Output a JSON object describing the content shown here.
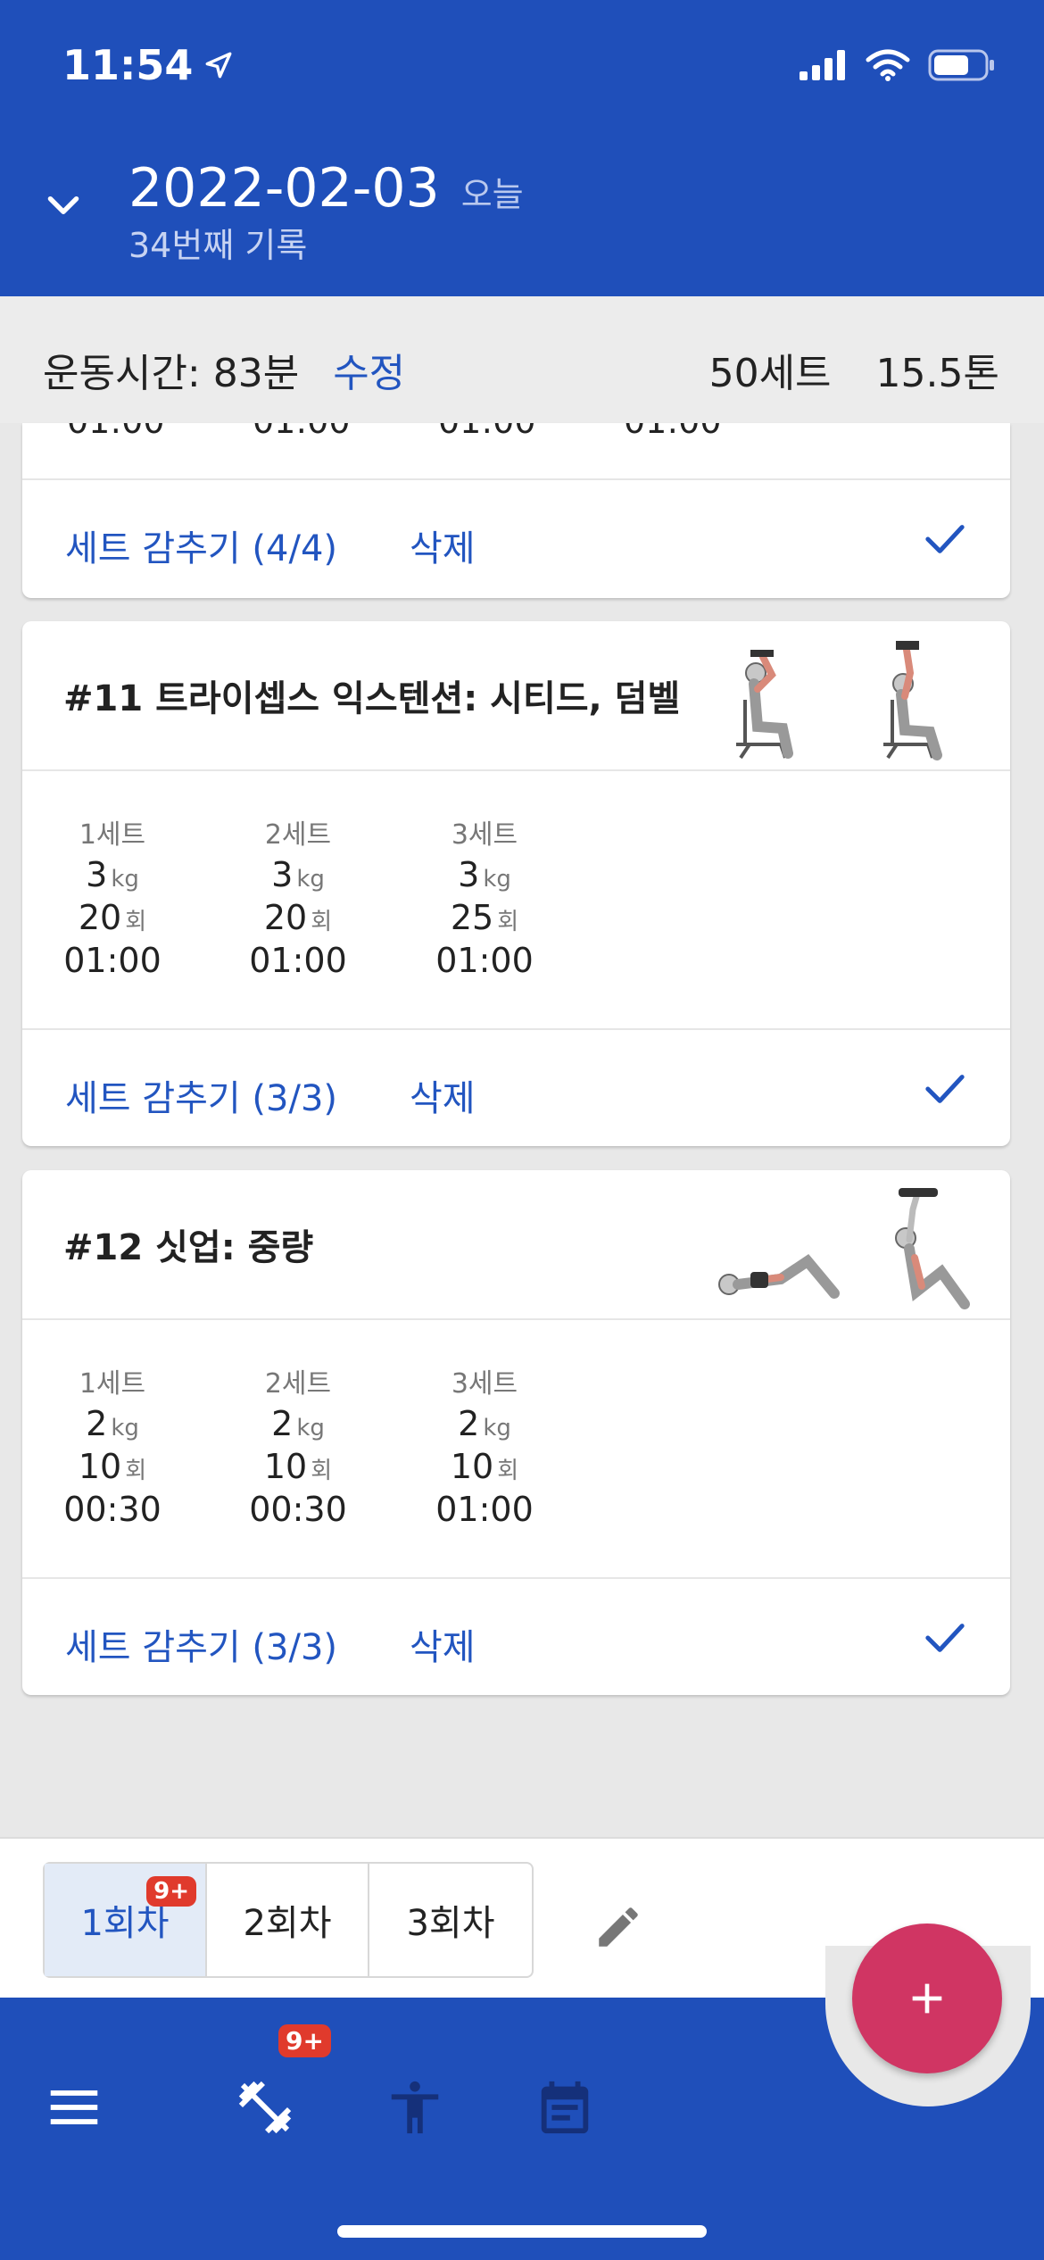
{
  "status_bar": {
    "time": "11:54"
  },
  "header": {
    "date": "2022-02-03",
    "today_label": "오늘",
    "record_count": "34번째 기록"
  },
  "summary": {
    "duration": "운동시간: 83분",
    "edit_label": "수정",
    "total_sets": "50세트",
    "total_weight": "15.5톤"
  },
  "previous_card": {
    "hide_label": "세트 감추기 (4/4)",
    "delete_label": "삭제"
  },
  "cards": [
    {
      "title": "#11 트라이셉스 익스텐션: 시티드, 덤벨",
      "sets": [
        {
          "label": "1세트",
          "weight": "3",
          "weight_unit": "kg",
          "reps": "20",
          "reps_unit": "회",
          "time": "01:00"
        },
        {
          "label": "2세트",
          "weight": "3",
          "weight_unit": "kg",
          "reps": "20",
          "reps_unit": "회",
          "time": "01:00"
        },
        {
          "label": "3세트",
          "weight": "3",
          "weight_unit": "kg",
          "reps": "25",
          "reps_unit": "회",
          "time": "01:00"
        }
      ],
      "hide_label": "세트 감추기 (3/3)",
      "delete_label": "삭제"
    },
    {
      "title": "#12 싯업: 중량",
      "sets": [
        {
          "label": "1세트",
          "weight": "2",
          "weight_unit": "kg",
          "reps": "10",
          "reps_unit": "회",
          "time": "00:30"
        },
        {
          "label": "2세트",
          "weight": "2",
          "weight_unit": "kg",
          "reps": "10",
          "reps_unit": "회",
          "time": "00:30"
        },
        {
          "label": "3세트",
          "weight": "2",
          "weight_unit": "kg",
          "reps": "10",
          "reps_unit": "회",
          "time": "01:00"
        }
      ],
      "hide_label": "세트 감추기 (3/3)",
      "delete_label": "삭제"
    }
  ],
  "session_tabs": [
    {
      "label": "1회차",
      "active": true,
      "badge": "9+"
    },
    {
      "label": "2회차",
      "active": false
    },
    {
      "label": "3회차",
      "active": false
    }
  ],
  "nav": {
    "workout_badge": "9+",
    "icons": [
      "menu-icon",
      "dumbbell-icon",
      "body-icon",
      "calendar-icon"
    ]
  },
  "fab_label": "+",
  "colors": {
    "brand_blue": "#1f4fba",
    "link_blue": "#2255c0",
    "fab_pink": "#d03563",
    "badge_red": "#e03a2c"
  }
}
